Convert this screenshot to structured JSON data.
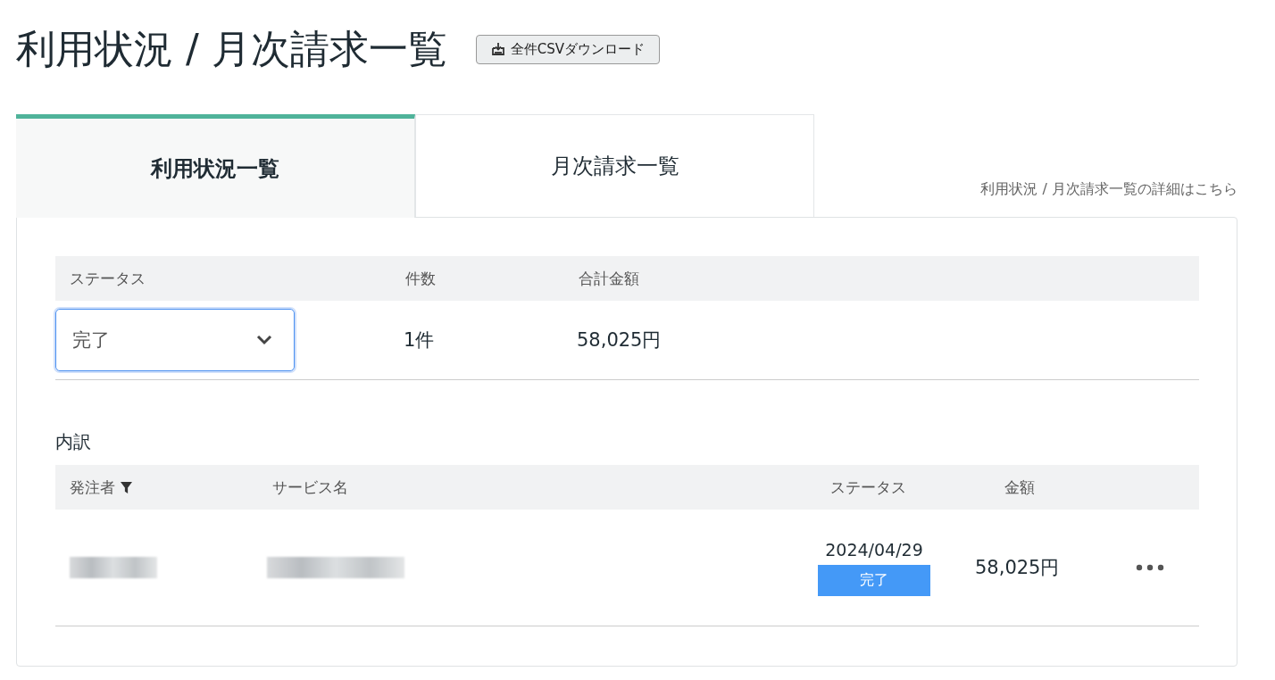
{
  "page_title": "利用状況 / 月次請求一覧",
  "download_button": {
    "label": "全件CSVダウンロード"
  },
  "tabs": [
    {
      "label": "利用状況一覧",
      "selected": true
    },
    {
      "label": "月次請求一覧",
      "selected": false
    }
  ],
  "details_link": "利用状況 / 月次請求一覧の詳細はこちら",
  "summary": {
    "columns": [
      "ステータス",
      "件数",
      "合計金額"
    ],
    "status_select": {
      "value": "完了"
    },
    "count": "1件",
    "total": "58,025円"
  },
  "breakdown": {
    "title": "内訳",
    "columns": [
      {
        "label": "発注者",
        "filter": true
      },
      {
        "label": "サービス名",
        "filter": false
      },
      {
        "label": "ステータス",
        "filter": false
      },
      {
        "label": "金額",
        "filter": false
      }
    ],
    "rows": [
      {
        "orderer_redacted": true,
        "service_redacted": true,
        "date": "2024/04/29",
        "status": "完了",
        "amount": "58,025円"
      }
    ]
  }
}
